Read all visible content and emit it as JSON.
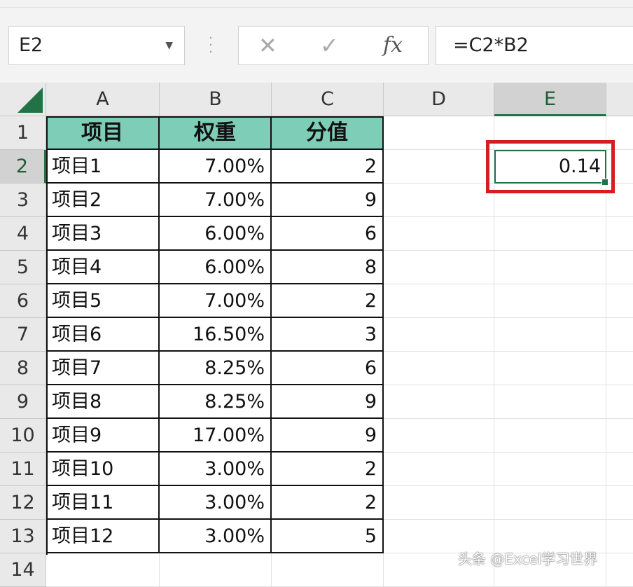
{
  "name_box": {
    "value": "E2",
    "dropdown_icon": "caret-down-icon"
  },
  "formula_bar": {
    "cancel_icon": "close-icon",
    "cancel_glyph": "✕",
    "enter_icon": "checkmark-icon",
    "enter_glyph": "✓",
    "function_label": "fx",
    "formula": "=C2*B2"
  },
  "columns": [
    "A",
    "B",
    "C",
    "D",
    "E"
  ],
  "selected_column": "E",
  "rows": [
    "1",
    "2",
    "3",
    "4",
    "5",
    "6",
    "7",
    "8",
    "9",
    "10",
    "11",
    "12",
    "13",
    "14"
  ],
  "selected_row": "2",
  "table": {
    "headers": [
      "项目",
      "权重",
      "分值"
    ],
    "body": [
      [
        "项目1",
        "7.00%",
        "2"
      ],
      [
        "项目2",
        "7.00%",
        "9"
      ],
      [
        "项目3",
        "6.00%",
        "6"
      ],
      [
        "项目4",
        "6.00%",
        "8"
      ],
      [
        "项目5",
        "7.00%",
        "2"
      ],
      [
        "项目6",
        "16.50%",
        "3"
      ],
      [
        "项目7",
        "8.25%",
        "6"
      ],
      [
        "项目8",
        "8.25%",
        "9"
      ],
      [
        "项目9",
        "17.00%",
        "9"
      ],
      [
        "项目10",
        "3.00%",
        "2"
      ],
      [
        "项目11",
        "3.00%",
        "2"
      ],
      [
        "项目12",
        "3.00%",
        "5"
      ]
    ]
  },
  "active_cell": {
    "ref": "E2",
    "value": "0.14"
  },
  "highlight_color": "#d71d24",
  "header_fill_color": "#7ecdb6",
  "accent_color": "#217346",
  "watermark": "头条 @Excel学习世界"
}
